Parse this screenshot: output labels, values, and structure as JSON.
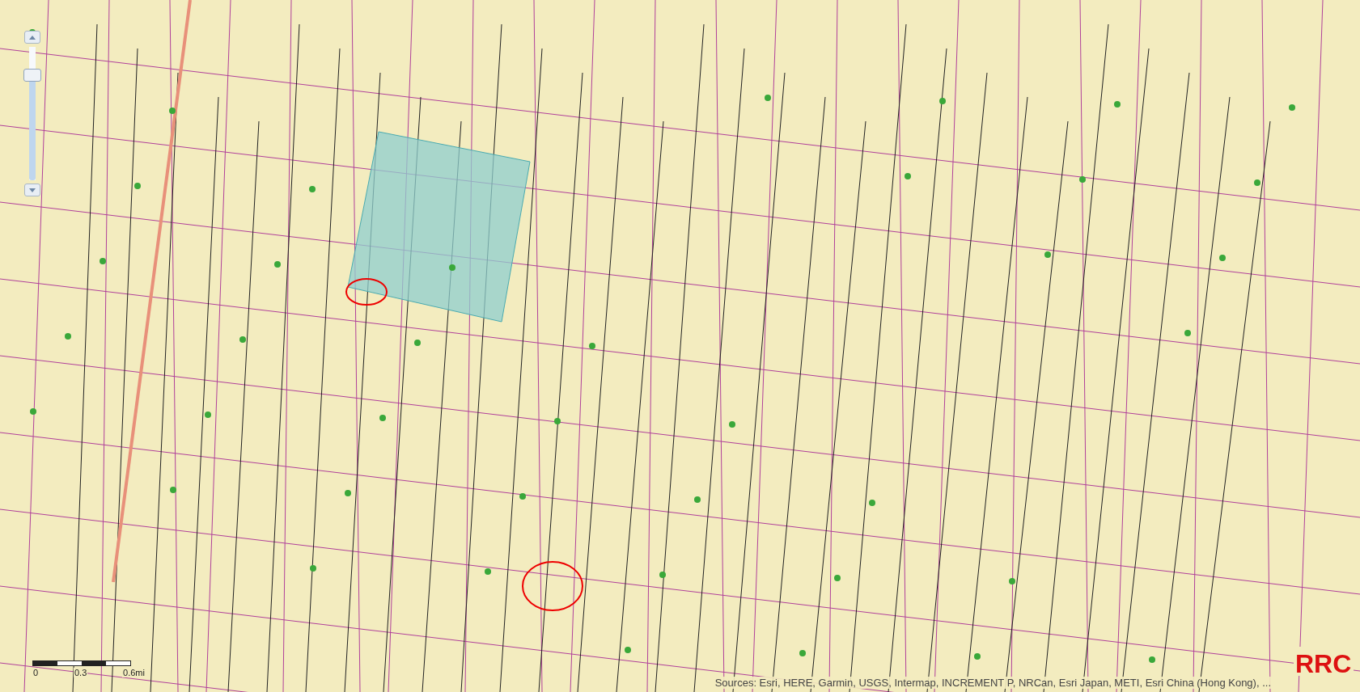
{
  "zoom_slider": {
    "level": 0.82
  },
  "scale_bar": {
    "ticks": [
      "0",
      "0.3",
      "0.6mi"
    ]
  },
  "attribution": "Sources: Esri, HERE, Garmin, USGS, Intermap, INCREMENT P, NRCan, Esri Japan, METI, Esri China (Hong Kong), ...",
  "logo": {
    "text": "RRC"
  }
}
